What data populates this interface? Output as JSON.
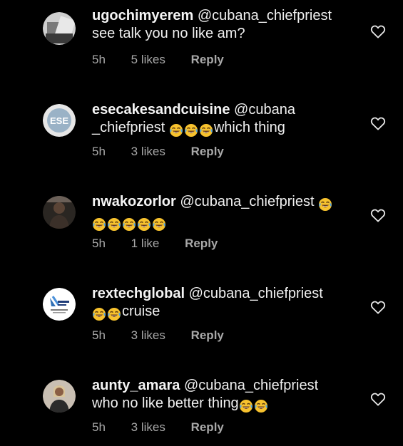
{
  "comments": [
    {
      "username": "ugochimyerem",
      "mention": "@cubana_chiefpriest",
      "line2": "see talk you no like am?",
      "time": "5h",
      "likes": "5 likes",
      "reply": "Reply",
      "avatar_icon": "avatar-image"
    },
    {
      "username": "esecakesandcuisine",
      "mention": "@cubana",
      "line2a": "_chiefpriest",
      "line2b": "which thing",
      "time": "5h",
      "likes": "3 likes",
      "reply": "Reply",
      "avatar_text": "ESE"
    },
    {
      "username": "nwakozorlor",
      "mention": "@cubana_chiefpriest",
      "time": "5h",
      "likes": "1 like",
      "reply": "Reply",
      "avatar_icon": "avatar-image"
    },
    {
      "username": "rextechglobal",
      "mention": "@cubana_chiefpriest",
      "line2": "cruise",
      "time": "5h",
      "likes": "3 likes",
      "reply": "Reply",
      "avatar_icon": "logo-image"
    },
    {
      "username": "aunty_amara",
      "mention": "@cubana_chiefpriest",
      "line2": "who no like better thing",
      "time": "5h",
      "likes": "3 likes",
      "reply": "Reply",
      "avatar_icon": "avatar-image"
    }
  ],
  "icons": {
    "heart": "heart-outline-icon",
    "emoji": "face-with-tears-of-joy-emoji"
  },
  "colors": {
    "background": "#000000",
    "text": "#f2f2f2",
    "meta": "#a8a8a8",
    "emoji_face": "#f7c22e"
  }
}
